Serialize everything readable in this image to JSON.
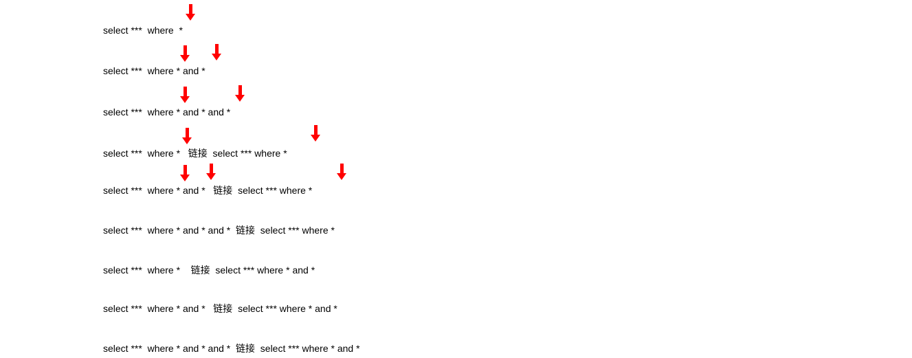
{
  "lines": {
    "l1": "select ***  where  *",
    "l2": "select ***  where * and *",
    "l3": "select ***  where * and * and *",
    "l4": "select ***  where *   链接  select *** where *",
    "l5": "select ***  where * and *   链接  select *** where *",
    "l6": "select ***  where * and * and *  链接  select *** where *",
    "l7": "select ***  where *    链接  select *** where * and *",
    "l8": "select ***  where * and *   链接  select *** where * and *",
    "l9": "select ***  where * and * and *  链接  select *** where * and *"
  },
  "arrow_color": "#ff0000"
}
